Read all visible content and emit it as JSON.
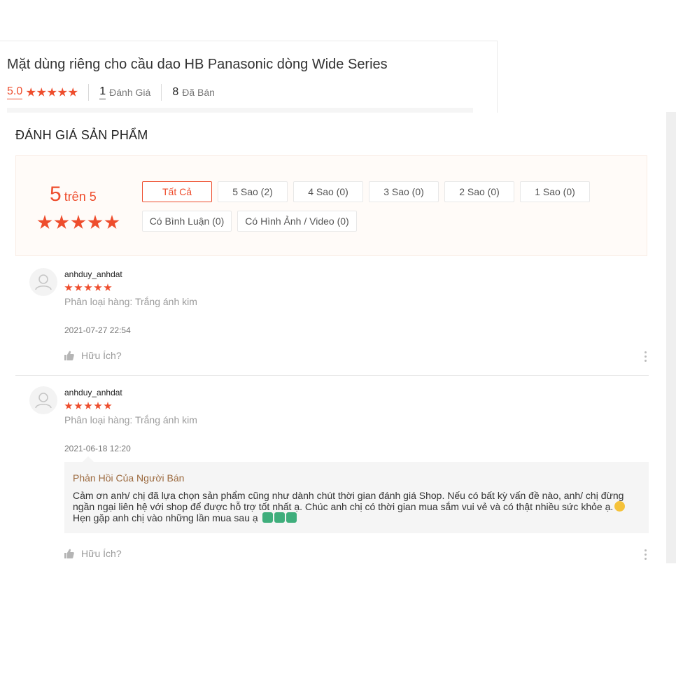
{
  "product": {
    "title": "Mặt dùng riêng cho cầu dao HB Panasonic dòng Wide Series",
    "rating": "5.0",
    "review_count": "1",
    "review_label": "Đánh Giá",
    "sold_count": "8",
    "sold_label": "Đã Bán",
    "star_color": "#ee4d2d"
  },
  "section": {
    "heading": "ĐÁNH GIÁ SẢN PHẨM"
  },
  "overview": {
    "score": "5",
    "score_suffix": "trên 5",
    "stars": 5
  },
  "filters": [
    {
      "label": "Tất Cả",
      "active": true
    },
    {
      "label": "5 Sao (2)",
      "active": false
    },
    {
      "label": "4 Sao (0)",
      "active": false
    },
    {
      "label": "3 Sao (0)",
      "active": false
    },
    {
      "label": "2 Sao (0)",
      "active": false
    },
    {
      "label": "1 Sao (0)",
      "active": false
    },
    {
      "label": "Có Bình Luận (0)",
      "active": false
    },
    {
      "label": "Có Hình Ảnh / Video (0)",
      "active": false
    }
  ],
  "reviews": [
    {
      "username": "anhduy_anhdat",
      "stars": 5,
      "variant": "Phân loại hàng: Trắng ánh kim",
      "date": "2021-07-27 22:54",
      "helpful_label": "Hữu Ích?"
    },
    {
      "username": "anhduy_anhdat",
      "stars": 5,
      "variant": "Phân loại hàng: Trắng ánh kim",
      "date": "2021-06-18 12:20",
      "helpful_label": "Hữu Ích?",
      "seller_reply": {
        "title": "Phản Hồi Của Người Bán",
        "text": "Cảm ơn anh/ chị đã lựa chọn sản phẩm cũng như dành chút thời gian đánh giá Shop. Nếu có bất kỳ vấn đề nào, anh/ chị đừng ngần ngại liên hệ với shop để được hỗ trợ tốt nhất ạ. Chúc anh chị có thời gian mua sắm vui vẻ và có thật nhiều sức khỏe ạ.",
        "text2": "Hẹn gặp anh chị vào những lần mua sau ạ"
      }
    }
  ],
  "icons": {
    "avatar": "user-avatar-icon",
    "thumb": "thumbs-up-icon",
    "more": "more-vertical-icon",
    "star": "star-icon"
  }
}
